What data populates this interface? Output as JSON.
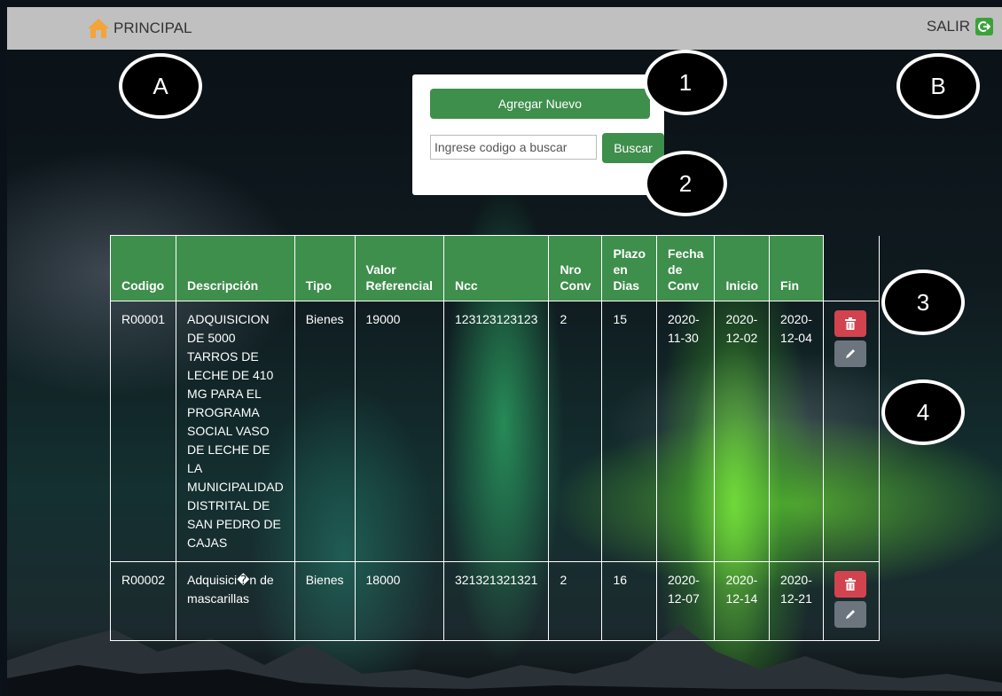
{
  "header": {
    "home_label": "PRINCIPAL",
    "logout_label": "SALIR"
  },
  "callouts": {
    "a": "A",
    "b": "B",
    "one": "1",
    "two": "2",
    "three": "3",
    "four": "4"
  },
  "panel": {
    "add_label": "Agregar Nuevo",
    "search_placeholder": "Ingrese codigo a buscar",
    "search_label": "Buscar"
  },
  "table": {
    "headers": [
      "Codigo",
      "Descripción",
      "Tipo",
      "Valor Referencial",
      "Ncc",
      "Nro Conv",
      "Plazo en Dias",
      "Fecha de Conv",
      "Inicio",
      "Fin"
    ],
    "rows": [
      {
        "codigo": "R00001",
        "descripcion": "ADQUISICION DE 5000 TARROS DE LECHE DE 410 MG PARA EL PROGRAMA SOCIAL VASO DE LECHE DE LA MUNICIPALIDAD DISTRITAL DE SAN PEDRO DE CAJAS",
        "tipo": "Bienes",
        "valor": "19000",
        "ncc": "123123123123",
        "nro_conv": "2",
        "plazo": "15",
        "fecha_conv": "2020-11-30",
        "inicio": "2020-12-02",
        "fin": "2020-12-04"
      },
      {
        "codigo": "R00002",
        "descripcion": "Adquisici�n de mascarillas",
        "tipo": "Bienes",
        "valor": "18000",
        "ncc": "321321321321",
        "nro_conv": "2",
        "plazo": "16",
        "fecha_conv": "2020-12-07",
        "inicio": "2020-12-14",
        "fin": "2020-12-21"
      }
    ]
  },
  "colors": {
    "brand_green": "#3e8e4c",
    "delete_red": "#d2434f",
    "edit_gray": "#6c757d",
    "topbar": "#c0c0c0"
  },
  "icons": {
    "home": "home-icon",
    "logout": "logout-icon",
    "delete": "trash-icon",
    "edit": "pencil-icon"
  }
}
